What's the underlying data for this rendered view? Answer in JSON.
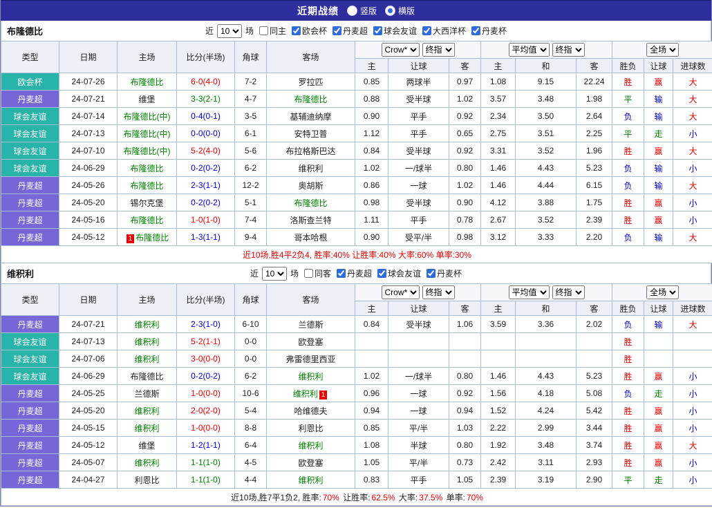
{
  "colors": {
    "red": "#e60000",
    "blue": "#0000cc",
    "green": "#008000",
    "teal": "#29b4aa",
    "purple": "#7667d8",
    "dark": "#222222",
    "topbar_bg": "#2e2e9e",
    "header_bg": "#eef0f7",
    "border": "#a9bdd6",
    "radio_accent": "#2f6bd9"
  },
  "topbar": {
    "title": "近期战绩",
    "radio_vertical": "竖版",
    "radio_horizontal": "横版"
  },
  "sections": [
    {
      "team": "布隆德比",
      "filter": {
        "near": "近",
        "count": "10",
        "games": "场",
        "same": {
          "label": "同主",
          "checked": false
        },
        "leagues": [
          {
            "label": "欧会杯",
            "checked": true
          },
          {
            "label": "丹麦超",
            "checked": true
          },
          {
            "label": "球会友谊",
            "checked": true
          },
          {
            "label": "大西洋杯",
            "checked": true
          },
          {
            "label": "丹麦杯",
            "checked": true
          }
        ]
      },
      "dropdowns": {
        "book": "Crow*",
        "book_mode": "终指",
        "avg": "平均值",
        "avg_mode": "终指",
        "scope": "全场"
      },
      "columns": {
        "type": "类型",
        "date": "日期",
        "home": "主场",
        "score": "比分(半场)",
        "corner": "角球",
        "away": "客场",
        "sub": [
          "主",
          "让球",
          "客",
          "主",
          "和",
          "客",
          "胜负",
          "让球",
          "进球数"
        ]
      },
      "rows": [
        {
          "league": "欧会杯",
          "lc": "teal",
          "date": "24-07-26",
          "home": {
            "text": "布隆德比",
            "green": true
          },
          "score": {
            "text": "6-0(4-0)",
            "c": "red"
          },
          "corner": "7-2",
          "away": {
            "text": "罗拉匹",
            "green": false
          },
          "odds": [
            "0.85",
            "两球半",
            "0.97",
            "1.08",
            "9.15",
            "22.24"
          ],
          "results": [
            {
              "t": "胜",
              "c": "red"
            },
            {
              "t": "赢",
              "c": "red"
            },
            {
              "t": "大",
              "c": "red"
            }
          ]
        },
        {
          "league": "丹麦超",
          "lc": "purple",
          "date": "24-07-21",
          "home": {
            "text": "维堡",
            "green": false
          },
          "score": {
            "text": "3-3(2-1)",
            "c": "green"
          },
          "corner": "4-7",
          "away": {
            "text": "布隆德比",
            "green": true
          },
          "odds": [
            "0.88",
            "受半球",
            "1.02",
            "3.57",
            "3.48",
            "1.98"
          ],
          "results": [
            {
              "t": "平",
              "c": "green"
            },
            {
              "t": "输",
              "c": "blue"
            },
            {
              "t": "大",
              "c": "red"
            }
          ]
        },
        {
          "league": "球会友谊",
          "lc": "teal",
          "date": "24-07-14",
          "home": {
            "text": "布隆德比(中)",
            "green": true
          },
          "score": {
            "text": "0-4(0-1)",
            "c": "blue"
          },
          "corner": "3-5",
          "away": {
            "text": "基辅迪纳摩",
            "green": false
          },
          "odds": [
            "0.90",
            "平手",
            "0.92",
            "2.34",
            "3.50",
            "2.64"
          ],
          "results": [
            {
              "t": "负",
              "c": "blue"
            },
            {
              "t": "输",
              "c": "blue"
            },
            {
              "t": "大",
              "c": "red"
            }
          ]
        },
        {
          "league": "球会友谊",
          "lc": "teal",
          "date": "24-07-13",
          "home": {
            "text": "布隆德比(中)",
            "green": true
          },
          "score": {
            "text": "0-0(0-0)",
            "c": "blue"
          },
          "corner": "6-1",
          "away": {
            "text": "安特卫普",
            "green": false
          },
          "odds": [
            "1.12",
            "平手",
            "0.65",
            "2.75",
            "3.51",
            "2.25"
          ],
          "results": [
            {
              "t": "平",
              "c": "green"
            },
            {
              "t": "走",
              "c": "green"
            },
            {
              "t": "小",
              "c": "blue"
            }
          ]
        },
        {
          "league": "球会友谊",
          "lc": "teal",
          "date": "24-07-10",
          "home": {
            "text": "布隆德比(中)",
            "green": true
          },
          "score": {
            "text": "5-2(4-0)",
            "c": "red"
          },
          "corner": "5-6",
          "away": {
            "text": "布拉格斯巴达",
            "green": false
          },
          "odds": [
            "0.84",
            "受半球",
            "0.92",
            "3.31",
            "3.52",
            "1.96"
          ],
          "results": [
            {
              "t": "胜",
              "c": "red"
            },
            {
              "t": "赢",
              "c": "red"
            },
            {
              "t": "大",
              "c": "red"
            }
          ]
        },
        {
          "league": "球会友谊",
          "lc": "teal",
          "date": "24-06-29",
          "home": {
            "text": "布隆德比",
            "green": true
          },
          "score": {
            "text": "0-2(0-2)",
            "c": "blue"
          },
          "corner": "6-2",
          "away": {
            "text": "维积利",
            "green": false
          },
          "odds": [
            "1.02",
            "一/球半",
            "0.80",
            "1.46",
            "4.43",
            "5.23"
          ],
          "results": [
            {
              "t": "负",
              "c": "blue"
            },
            {
              "t": "输",
              "c": "blue"
            },
            {
              "t": "小",
              "c": "blue"
            }
          ]
        },
        {
          "league": "丹麦超",
          "lc": "purple",
          "date": "24-05-26",
          "home": {
            "text": "布隆德比",
            "green": true
          },
          "score": {
            "text": "2-3(1-1)",
            "c": "blue"
          },
          "corner": "12-2",
          "away": {
            "text": "奥胡斯",
            "green": false
          },
          "odds": [
            "0.86",
            "一球",
            "1.02",
            "1.46",
            "4.44",
            "6.15"
          ],
          "results": [
            {
              "t": "负",
              "c": "blue"
            },
            {
              "t": "输",
              "c": "blue"
            },
            {
              "t": "大",
              "c": "red"
            }
          ]
        },
        {
          "league": "丹麦超",
          "lc": "purple",
          "date": "24-05-20",
          "home": {
            "text": "锡尔克堡",
            "green": false
          },
          "score": {
            "text": "0-2(0-2)",
            "c": "blue"
          },
          "corner": "5-1",
          "away": {
            "text": "布隆德比",
            "green": true
          },
          "odds": [
            "0.98",
            "受半球",
            "0.90",
            "4.12",
            "3.88",
            "1.75"
          ],
          "results": [
            {
              "t": "胜",
              "c": "red"
            },
            {
              "t": "赢",
              "c": "red"
            },
            {
              "t": "小",
              "c": "blue"
            }
          ]
        },
        {
          "league": "丹麦超",
          "lc": "purple",
          "date": "24-05-16",
          "home": {
            "text": "布隆德比",
            "green": true
          },
          "score": {
            "text": "1-0(1-0)",
            "c": "red"
          },
          "corner": "7-4",
          "away": {
            "text": "洛斯查兰特",
            "green": false
          },
          "odds": [
            "1.11",
            "平手",
            "0.78",
            "2.67",
            "3.52",
            "2.39"
          ],
          "results": [
            {
              "t": "胜",
              "c": "red"
            },
            {
              "t": "赢",
              "c": "red"
            },
            {
              "t": "小",
              "c": "blue"
            }
          ]
        },
        {
          "league": "丹麦超",
          "lc": "purple",
          "date": "24-05-12",
          "home": {
            "text": "布隆德比",
            "green": true,
            "badge": "1",
            "badge_pos": "before"
          },
          "score": {
            "text": "1-3(1-1)",
            "c": "blue"
          },
          "corner": "9-4",
          "away": {
            "text": "哥本哈根",
            "green": false
          },
          "odds": [
            "0.90",
            "受平/半",
            "0.98",
            "3.12",
            "3.33",
            "2.20"
          ],
          "results": [
            {
              "t": "负",
              "c": "blue"
            },
            {
              "t": "输",
              "c": "blue"
            },
            {
              "t": "大",
              "c": "red"
            }
          ]
        }
      ],
      "summary": [
        {
          "t": "近10场,胜4平2负4, 胜率:40% 让胜率:40% 大率:60% 单率:30%",
          "c": "red"
        }
      ]
    },
    {
      "team": "维积利",
      "filter": {
        "near": "近",
        "count": "10",
        "games": "场",
        "same": {
          "label": "同客",
          "checked": false
        },
        "leagues": [
          {
            "label": "丹麦超",
            "checked": true
          },
          {
            "label": "球会友谊",
            "checked": true
          },
          {
            "label": "丹麦杯",
            "checked": true
          }
        ]
      },
      "dropdowns": {
        "book": "Crow*",
        "book_mode": "终指",
        "avg": "平均值",
        "avg_mode": "终指",
        "scope": "全场"
      },
      "columns": {
        "type": "类型",
        "date": "日期",
        "home": "主场",
        "score": "比分(半场)",
        "corner": "角球",
        "away": "客场",
        "sub": [
          "主",
          "让球",
          "客",
          "主",
          "和",
          "客",
          "胜负",
          "让球",
          "进球数"
        ]
      },
      "rows": [
        {
          "league": "丹麦超",
          "lc": "purple",
          "date": "24-07-21",
          "home": {
            "text": "维积利",
            "green": true
          },
          "score": {
            "text": "2-3(1-0)",
            "c": "blue"
          },
          "corner": "6-10",
          "away": {
            "text": "兰德斯",
            "green": false
          },
          "odds": [
            "0.84",
            "受半球",
            "1.06",
            "3.59",
            "3.36",
            "2.02"
          ],
          "results": [
            {
              "t": "负",
              "c": "blue"
            },
            {
              "t": "输",
              "c": "blue"
            },
            {
              "t": "大",
              "c": "red"
            }
          ]
        },
        {
          "league": "球会友谊",
          "lc": "teal",
          "date": "24-07-13",
          "home": {
            "text": "维积利",
            "green": true
          },
          "score": {
            "text": "5-2(1-1)",
            "c": "red"
          },
          "corner": "0-0",
          "away": {
            "text": "欧登塞",
            "green": false
          },
          "odds": [
            "",
            "",
            "",
            "",
            "",
            ""
          ],
          "results": [
            {
              "t": "胜",
              "c": "red"
            },
            {
              "t": "",
              "c": "dark"
            },
            {
              "t": "",
              "c": "dark"
            }
          ]
        },
        {
          "league": "球会友谊",
          "lc": "teal",
          "date": "24-07-06",
          "home": {
            "text": "维积利",
            "green": true
          },
          "score": {
            "text": "3-0(0-0)",
            "c": "red"
          },
          "corner": "0-0",
          "away": {
            "text": "弗雷德里西亚",
            "green": false
          },
          "odds": [
            "",
            "",
            "",
            "",
            "",
            ""
          ],
          "results": [
            {
              "t": "胜",
              "c": "red"
            },
            {
              "t": "",
              "c": "dark"
            },
            {
              "t": "",
              "c": "dark"
            }
          ]
        },
        {
          "league": "球会友谊",
          "lc": "teal",
          "date": "24-06-29",
          "home": {
            "text": "布隆德比",
            "green": false
          },
          "score": {
            "text": "0-2(0-2)",
            "c": "blue"
          },
          "corner": "6-2",
          "away": {
            "text": "维积利",
            "green": true
          },
          "odds": [
            "1.02",
            "一/球半",
            "0.80",
            "1.46",
            "4.43",
            "5.23"
          ],
          "results": [
            {
              "t": "胜",
              "c": "red"
            },
            {
              "t": "赢",
              "c": "red"
            },
            {
              "t": "小",
              "c": "blue"
            }
          ]
        },
        {
          "league": "丹麦超",
          "lc": "purple",
          "date": "24-05-25",
          "home": {
            "text": "兰德斯",
            "green": false
          },
          "score": {
            "text": "1-0(0-0)",
            "c": "red"
          },
          "corner": "10-6",
          "away": {
            "text": "维积利",
            "green": true,
            "badge": "1",
            "badge_pos": "after"
          },
          "odds": [
            "0.96",
            "一球",
            "0.92",
            "1.56",
            "4.18",
            "5.08"
          ],
          "results": [
            {
              "t": "负",
              "c": "blue"
            },
            {
              "t": "走",
              "c": "green"
            },
            {
              "t": "小",
              "c": "blue"
            }
          ]
        },
        {
          "league": "丹麦超",
          "lc": "purple",
          "date": "24-05-20",
          "home": {
            "text": "维积利",
            "green": true
          },
          "score": {
            "text": "2-0(2-0)",
            "c": "red"
          },
          "corner": "5-4",
          "away": {
            "text": "哈维德夫",
            "green": false
          },
          "odds": [
            "0.94",
            "一球",
            "0.94",
            "1.52",
            "4.24",
            "5.42"
          ],
          "results": [
            {
              "t": "胜",
              "c": "red"
            },
            {
              "t": "赢",
              "c": "red"
            },
            {
              "t": "小",
              "c": "blue"
            }
          ]
        },
        {
          "league": "丹麦超",
          "lc": "purple",
          "date": "24-05-15",
          "home": {
            "text": "维积利",
            "green": true
          },
          "score": {
            "text": "1-0(0-0)",
            "c": "red"
          },
          "corner": "8-8",
          "away": {
            "text": "利恩比",
            "green": false
          },
          "odds": [
            "0.85",
            "平/半",
            "1.03",
            "2.22",
            "2.99",
            "3.44"
          ],
          "results": [
            {
              "t": "胜",
              "c": "red"
            },
            {
              "t": "赢",
              "c": "red"
            },
            {
              "t": "小",
              "c": "blue"
            }
          ]
        },
        {
          "league": "丹麦超",
          "lc": "purple",
          "date": "24-05-12",
          "home": {
            "text": "维堡",
            "green": false
          },
          "score": {
            "text": "1-2(1-1)",
            "c": "blue"
          },
          "corner": "6-4",
          "away": {
            "text": "维积利",
            "green": true
          },
          "odds": [
            "1.08",
            "半球",
            "0.80",
            "1.92",
            "3.48",
            "3.74"
          ],
          "results": [
            {
              "t": "胜",
              "c": "red"
            },
            {
              "t": "赢",
              "c": "red"
            },
            {
              "t": "大",
              "c": "red"
            }
          ]
        },
        {
          "league": "丹麦超",
          "lc": "purple",
          "date": "24-05-07",
          "home": {
            "text": "维积利",
            "green": true
          },
          "score": {
            "text": "1-1(1-0)",
            "c": "green"
          },
          "corner": "4-5",
          "away": {
            "text": "欧登塞",
            "green": false
          },
          "odds": [
            "1.05",
            "平/半",
            "0.73",
            "2.42",
            "3.11",
            "2.93"
          ],
          "results": [
            {
              "t": "胜",
              "c": "red"
            },
            {
              "t": "赢",
              "c": "red"
            },
            {
              "t": "小",
              "c": "blue"
            }
          ]
        },
        {
          "league": "丹麦超",
          "lc": "purple",
          "date": "24-04-27",
          "home": {
            "text": "利恩比",
            "green": false
          },
          "score": {
            "text": "1-1(1-0)",
            "c": "green"
          },
          "corner": "4-4",
          "away": {
            "text": "维积利",
            "green": true
          },
          "odds": [
            "0.83",
            "平手",
            "1.05",
            "2.39",
            "3.19",
            "2.90"
          ],
          "results": [
            {
              "t": "平",
              "c": "green"
            },
            {
              "t": "走",
              "c": "green"
            },
            {
              "t": "小",
              "c": "blue"
            }
          ]
        }
      ],
      "summary": [
        {
          "t": "近10场,胜7平1负2, 胜率:",
          "c": "dark"
        },
        {
          "t": "70%",
          "c": "red"
        },
        {
          "t": " 让胜率:",
          "c": "dark"
        },
        {
          "t": "62.5%",
          "c": "red"
        },
        {
          "t": " 大率:",
          "c": "dark"
        },
        {
          "t": "37.5%",
          "c": "red"
        },
        {
          "t": " 单率:",
          "c": "dark"
        },
        {
          "t": "70%",
          "c": "red"
        }
      ]
    }
  ]
}
